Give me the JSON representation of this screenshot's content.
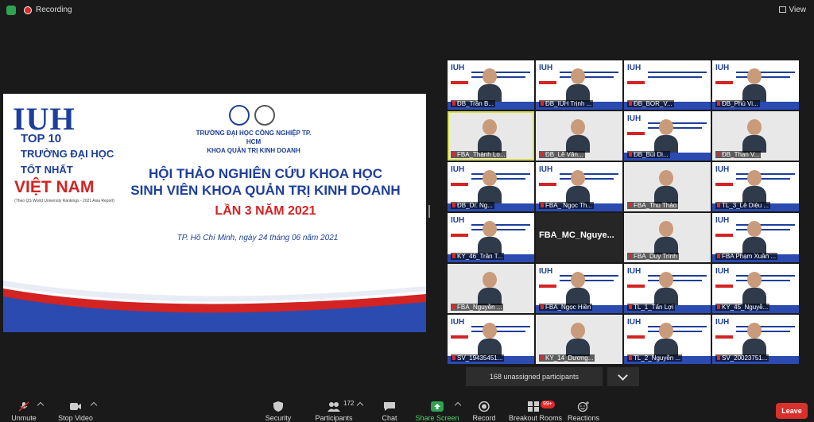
{
  "topbar": {
    "recording": "Recording",
    "view": "View"
  },
  "slide": {
    "logo_text": "IUH",
    "top10": "TOP 10",
    "line1": "TRƯỜNG ĐẠI HỌC",
    "line2": "TỐT NHẤT",
    "country": "VIỆT NAM",
    "note": "(Theo QS World University Rankings - 2021 Asia Report)",
    "school_line1": "TRƯỜNG ĐẠI HỌC CÔNG NGHIỆP TP. HCM",
    "school_line2": "KHOA QUẢN TRỊ KINH DOANH",
    "headline1": "HỘI THẢO NGHIÊN CỨU KHOA HỌC",
    "headline2": "SINH VIÊN KHOA QUẢN TRỊ KINH DOANH",
    "headline3": "LẦN 3 NĂM 2021",
    "date": "TP. Hồ Chí Minh, ngày 24 tháng 06 năm 2021"
  },
  "participants_grid": [
    "ĐB_Trần B...",
    "ĐB_IUH Trịnh ...",
    "ĐB_BOR_V...",
    "ĐB_Phú Vi...",
    "FBA_Thành Lo...",
    "ĐB_Lê Văn...",
    "ĐB_Bùi Di...",
    "ĐB_Than V...",
    "ĐB_Dr. Ng...",
    "FBA_ Ngọc Th...",
    "FBA_Thu Thảo",
    "TL_3_Lê Diệu ...",
    "KY_46_Trần T...",
    "FBA_MC_Nguye...",
    "FBA_Duy Trình",
    "FBA Phạm Xuân ...",
    "FBA_Nguyễn ...",
    "FBA_Ngọc Hiền",
    "TL_1_Tấn Lợi",
    "KY_45_Nguyễ...",
    "SV_19435451...",
    "KY_14_Dương...",
    "TL_2_Nguyễn ...",
    "SV_20023751..."
  ],
  "unassigned": "168 unassigned participants",
  "toolbar": {
    "unmute": "Unmute",
    "stop_video": "Stop Video",
    "security": "Security",
    "participants": "Participants",
    "participants_count": "172",
    "chat": "Chat",
    "share_screen": "Share Screen",
    "record": "Record",
    "breakout": "Breakout Rooms",
    "breakout_badge": "99+",
    "reactions": "Reactions",
    "leave": "Leave"
  },
  "colors": {
    "brand_blue": "#1d3f9b",
    "brand_red": "#d32323",
    "share_green": "#2ea44f",
    "leave_red": "#d9302c"
  }
}
